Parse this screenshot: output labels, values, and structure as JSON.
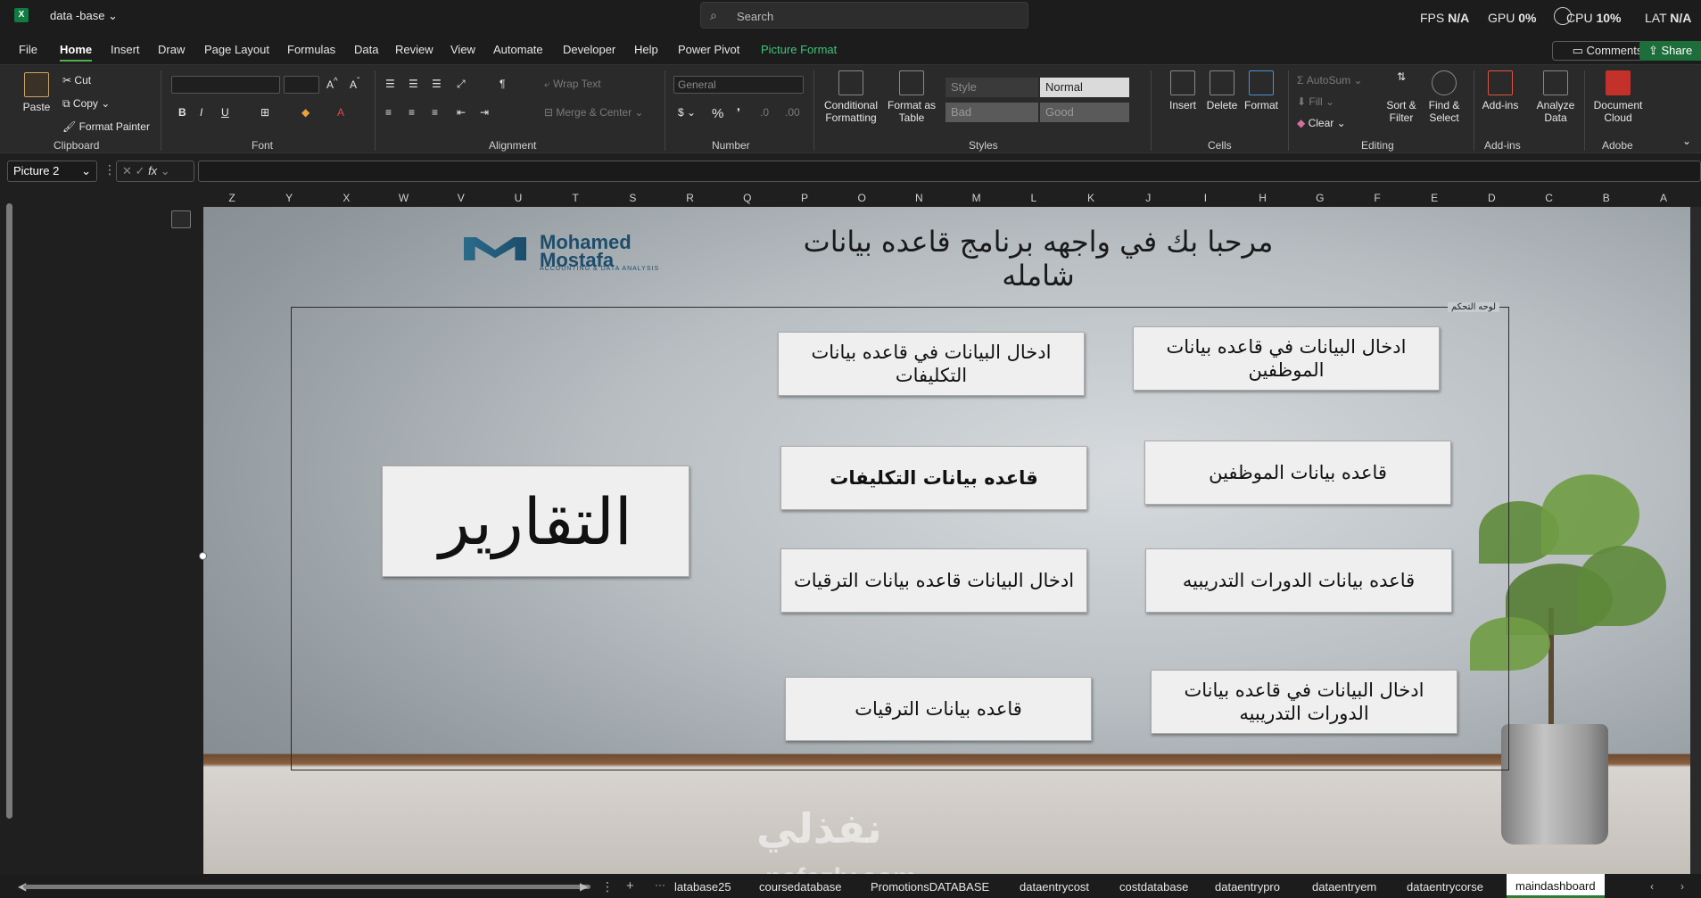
{
  "titlebar": {
    "filename": "data -base",
    "search_placeholder": "Search",
    "fps_label": "FPS",
    "fps_value": "N/A",
    "gpu_label": "GPU",
    "gpu_value": "0%",
    "cpu_label": "CPU",
    "cpu_value": "10%",
    "lat_label": "LAT",
    "lat_value": "N/A"
  },
  "menu": {
    "tabs": [
      "File",
      "Home",
      "Insert",
      "Draw",
      "Page Layout",
      "Formulas",
      "Data",
      "Review",
      "View",
      "Automate",
      "Developer",
      "Help",
      "Power Pivot",
      "Picture Format"
    ],
    "active": "Home",
    "comments": "Comments",
    "share": "Share"
  },
  "ribbon": {
    "clipboard": {
      "paste": "Paste",
      "cut": "Cut",
      "copy": "Copy",
      "format_painter": "Format Painter",
      "label": "Clipboard"
    },
    "font": {
      "label": "Font"
    },
    "alignment": {
      "wrap_text": "Wrap Text",
      "merge_center": "Merge & Center",
      "label": "Alignment"
    },
    "number": {
      "format": "General",
      "label": "Number"
    },
    "styles": {
      "conditional": "Conditional Formatting",
      "format_table": "Format as Table",
      "normal": "Normal",
      "bad": "Bad",
      "good": "Good",
      "style": "Style",
      "label": "Styles"
    },
    "cells": {
      "insert": "Insert",
      "delete": "Delete",
      "format": "Format",
      "label": "Cells"
    },
    "editing": {
      "autosum": "AutoSum",
      "fill": "Fill",
      "clear": "Clear",
      "sort_filter": "Sort & Filter",
      "find_select": "Find & Select",
      "label": "Editing"
    },
    "addins": {
      "addins": "Add-ins",
      "analyze": "Analyze Data",
      "label": "Add-ins"
    },
    "adobe": {
      "document_cloud": "Document Cloud",
      "label": "Adobe"
    }
  },
  "formula_bar": {
    "name_box": "Picture 2",
    "fx": "fx"
  },
  "columns": [
    "Z",
    "Y",
    "X",
    "W",
    "V",
    "U",
    "T",
    "S",
    "R",
    "Q",
    "P",
    "O",
    "N",
    "M",
    "L",
    "K",
    "J",
    "I",
    "H",
    "G",
    "F",
    "E",
    "D",
    "C",
    "B",
    "A"
  ],
  "dashboard": {
    "logo_name_1": "Mohamed",
    "logo_name_2": "Mostafa",
    "logo_subtitle": "ACCOUNTING & DATA ANALYSIS",
    "welcome": "مرحبا بك في واجهه برنامج قاعده بيانات شامله",
    "panel_label": "لوحه التحكم",
    "reports": "التقارير",
    "btn_enter_employees": "ادخال البيانات في قاعده بيانات  الموظفين",
    "btn_enter_costs": "ادخال البيانات في قاعده بيانات التكليفات",
    "btn_db_employees": "قاعده بيانات  الموظفين",
    "btn_db_costs": "قاعده بيانات التكليفات",
    "btn_db_courses": "قاعده بيانات  الدورات التدريبيه",
    "btn_enter_promotions": "ادخال البيانات قاعده بيانات الترقيات",
    "btn_db_promotions": "قاعده بيانات  الترقيات",
    "btn_enter_courses": "ادخال البيانات في قاعده بيانات  الدورات التدريبيه",
    "watermark": "نفذلي",
    "watermark_url": "nafezly.com"
  },
  "sheets": [
    "latabase25",
    "coursedatabase",
    "PromotionsDATABASE",
    "dataentrycost",
    "costdatabase",
    "dataentrypro",
    "dataentryem",
    "dataentrycorse",
    "maindashboard"
  ],
  "active_sheet": "maindashboard"
}
